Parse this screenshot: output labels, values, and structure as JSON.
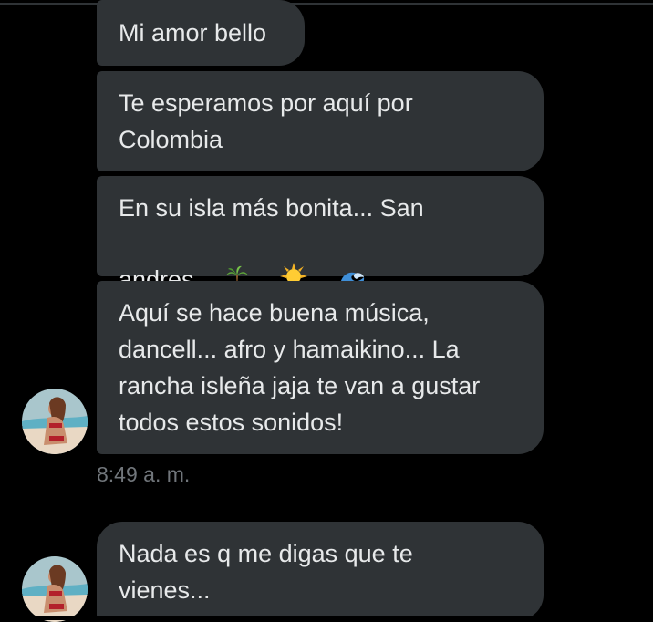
{
  "messages": [
    {
      "text": "Mi amor bello"
    },
    {
      "text": "Te esperamos por aquí por\nColombia"
    },
    {
      "text": "En su isla más bonita... San\nandres"
    },
    {
      "text": "Aquí se hace buena música,\ndancell... afro y hamaikino... La\nrancha isleña jaja te van a gustar\ntodos estos sonidos!"
    },
    {
      "text": "Nada es q me digas que te\nvienes..."
    }
  ],
  "timestamp": "8:49 a. m.",
  "emojis": [
    "palm-tree",
    "sun",
    "water-wave"
  ],
  "colors": {
    "background": "#000000",
    "bubble": "#2f3336",
    "text": "#e7e9ea",
    "muted": "#71767b"
  }
}
